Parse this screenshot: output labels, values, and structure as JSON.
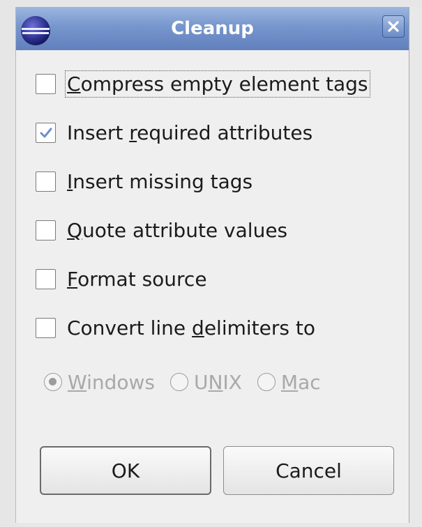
{
  "window": {
    "title": "Cleanup",
    "close_label": "✕"
  },
  "options": [
    {
      "label": "Compress empty element tags",
      "mnemonic": "C",
      "checked": false
    },
    {
      "label": "Insert required attributes",
      "mnemonic": "r",
      "checked": true
    },
    {
      "label": "Insert missing tags",
      "mnemonic": "I",
      "checked": false
    },
    {
      "label": "Quote attribute values",
      "mnemonic": "Q",
      "checked": false
    },
    {
      "label": "Format source",
      "mnemonic": "F",
      "checked": false
    },
    {
      "label": "Convert line delimiters to",
      "mnemonic": "d",
      "checked": false
    }
  ],
  "line_delimiters": {
    "enabled": false,
    "selected": "Windows",
    "choices": [
      {
        "label": "Windows",
        "mnemonic": "W"
      },
      {
        "label": "UNIX",
        "mnemonic": "N"
      },
      {
        "label": "Mac",
        "mnemonic": "M"
      }
    ]
  },
  "buttons": {
    "ok": "OK",
    "cancel": "Cancel"
  },
  "colors": {
    "titlebar": "#7796cd",
    "dialog_bg": "#efefef",
    "disabled_text": "#a9a9a9"
  }
}
